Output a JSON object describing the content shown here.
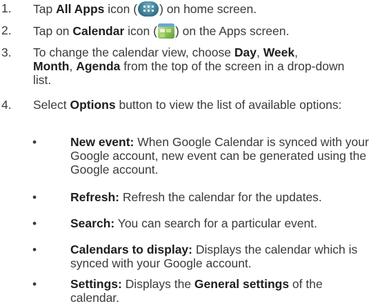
{
  "steps": [
    {
      "num": "1.",
      "pre": "Tap ",
      "bold1": "All Apps",
      "mid": " icon (",
      "icon": "all-apps-icon",
      "post": ") on home screen."
    },
    {
      "num": "2.",
      "pre": "Tap on ",
      "bold1": "Calendar",
      "mid": " icon (",
      "icon": "calendar-icon",
      "post": ") on the Apps screen."
    },
    {
      "num": "3.",
      "pre": "To change the calendar view, choose ",
      "day": "Day",
      "c1": ", ",
      "week": "Week",
      "c2": ",",
      "month": "Month",
      "c3": ", ",
      "agenda": "Agenda",
      "post": " from the top of the screen in a drop-down list."
    },
    {
      "num": "4.",
      "pre": "Select ",
      "bold1": "Options",
      "post": " button to view the list of available options:"
    }
  ],
  "options": [
    {
      "bullet": "•",
      "title": "New event:",
      "text": " When Google Calendar is synced with your Google account, new event can be generated using the Google account."
    },
    {
      "bullet": "•",
      "title": "Refresh:",
      "text": " Refresh the calendar for the updates."
    },
    {
      "bullet": "•",
      "title": "Search:",
      "text": " You can search for a particular event."
    },
    {
      "bullet": "•",
      "title": "Calendars to display:",
      "text": " Displays the calendar which is synced with your Google account."
    },
    {
      "bullet": "•",
      "title": "Settings:",
      "text": " Displays the ",
      "bold2": "General settings",
      "text2": " of the calendar."
    }
  ]
}
